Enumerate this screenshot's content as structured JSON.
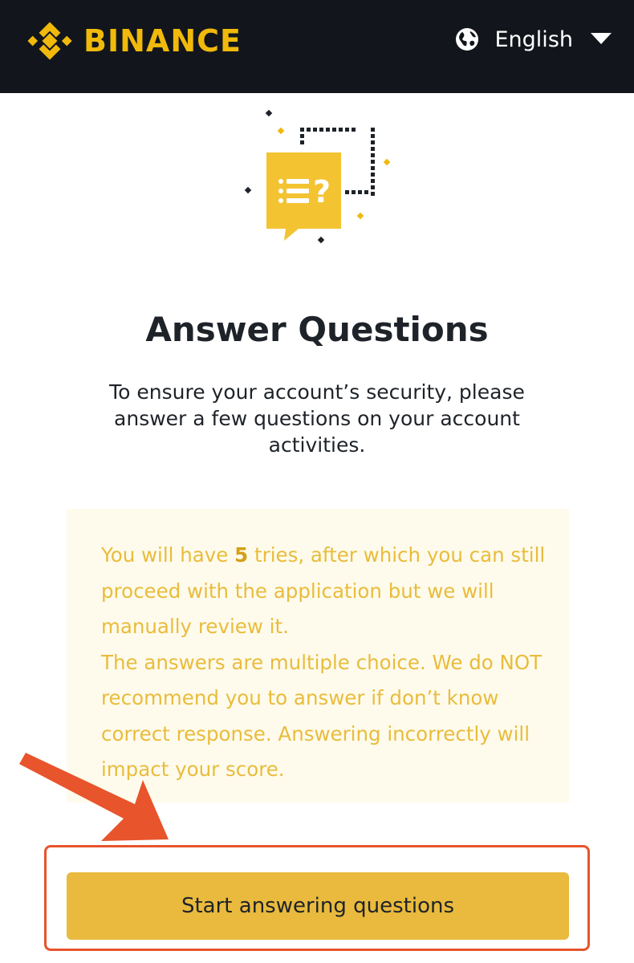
{
  "header": {
    "brand_name": "BINANCE",
    "language": {
      "label": "English",
      "icon": "globe-icon",
      "caret_icon": "caret-down-icon"
    }
  },
  "hero": {
    "icon": "question-list-chat-icon"
  },
  "main": {
    "title": "Answer Questions",
    "subtitle": "To ensure your account’s security, please answer a few questions on your account activities."
  },
  "notice": {
    "text_before_count": "You will have ",
    "tries_count": "5",
    "text_after_count": " tries, after which you can still proceed with the application but we will manually review it.",
    "paragraph_2": "The answers are multiple choice. We do NOT recommend you to answer if don’t know correct response. Answering incorrectly will impact your score."
  },
  "actions": {
    "start_label": "Start answering questions"
  },
  "annotation": {
    "arrow_icon": "arrow-icon",
    "highlight_color": "#E8542C"
  },
  "colors": {
    "header_bg": "#12161C",
    "brand": "#F0B90B",
    "notice_bg": "#FEFBEC",
    "notice_text": "#E9BC3C",
    "button_bg": "#E9BA3D"
  }
}
